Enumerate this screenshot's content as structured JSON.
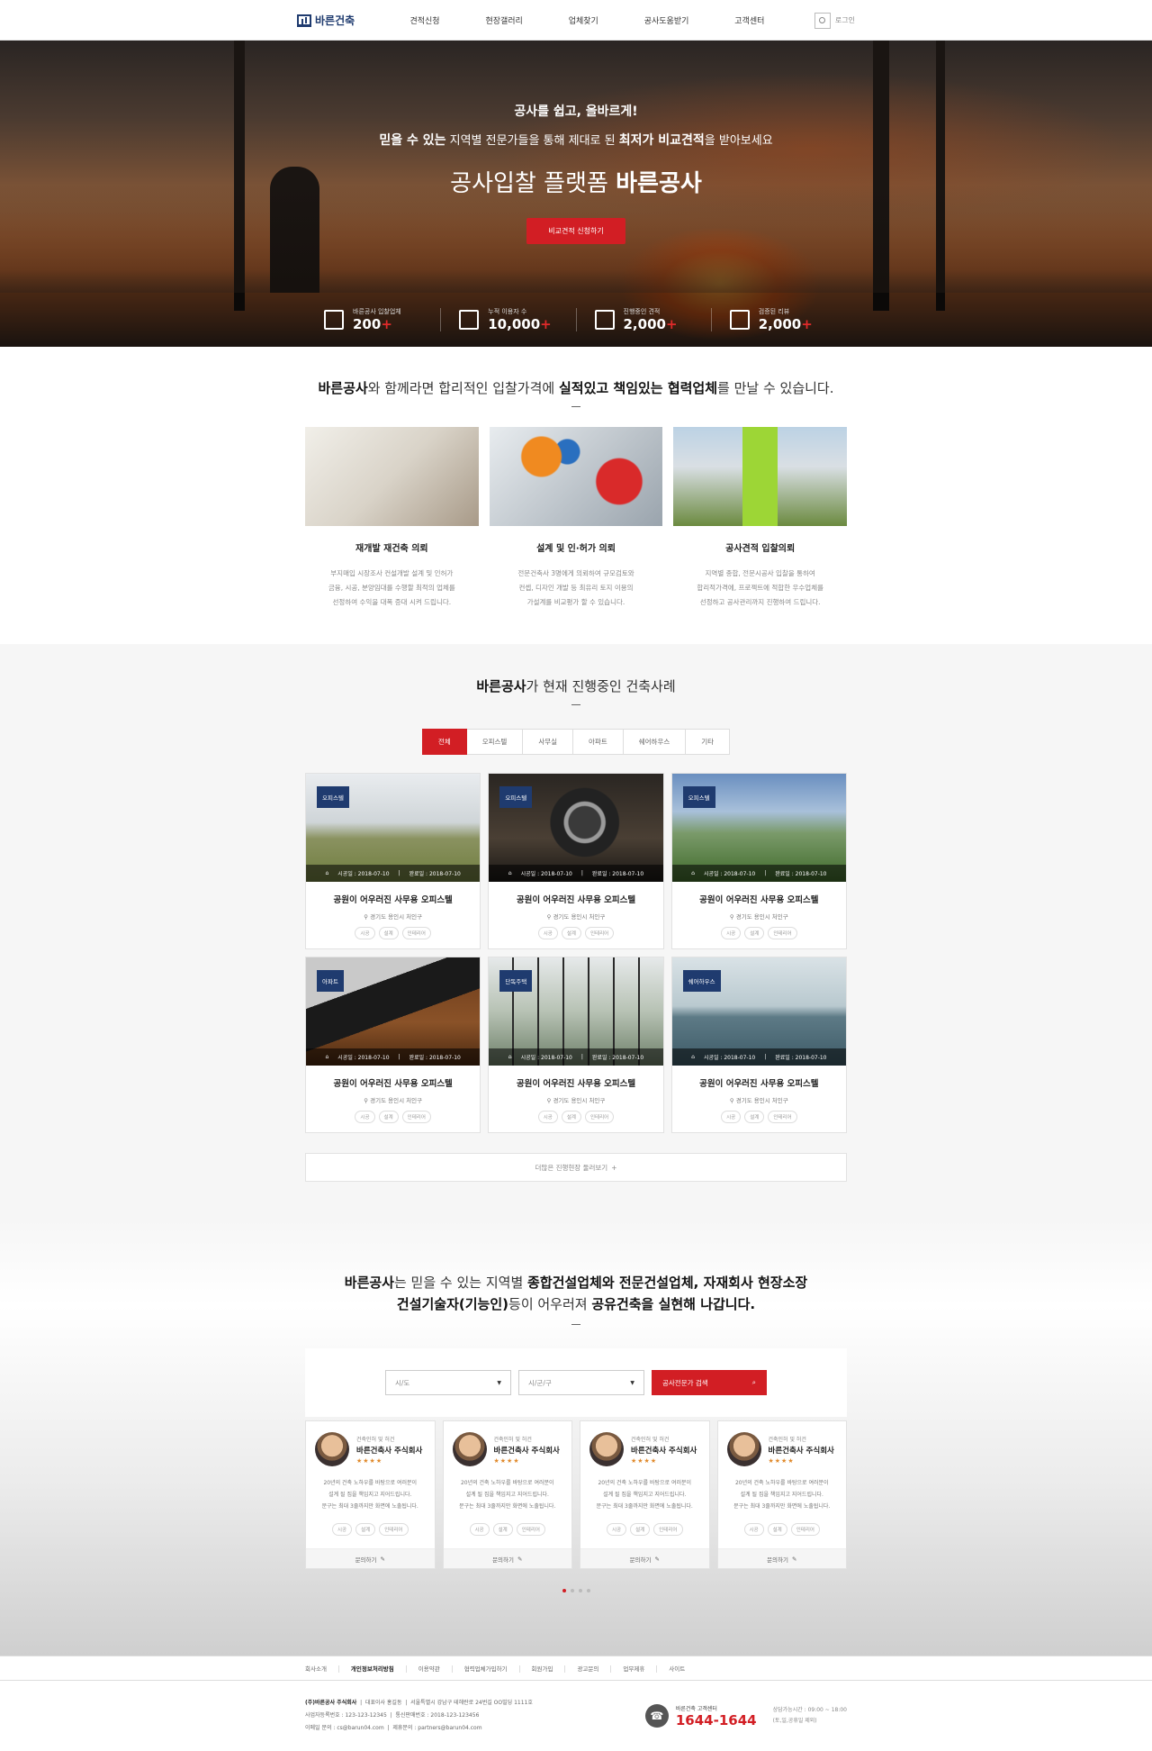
{
  "header": {
    "logo": "바른건축",
    "nav": [
      "견적신청",
      "현장갤러리",
      "업체찾기",
      "공사도움받기",
      "고객센터"
    ],
    "login": "로그인"
  },
  "hero": {
    "line1": "공사를 쉽고, 올바르게!",
    "line2_a": "믿을 수 있는",
    "line2_b": " 지역별 전문가들을 통해 제대로 된 ",
    "line2_c": "최저가 비교견적",
    "line2_d": "을 받아보세요",
    "line3_a": "공사입찰 플랫폼 ",
    "line3_b": "바른공사",
    "button": "비교견적 신청하기",
    "stats": [
      {
        "label": "바른공사 입찰업체",
        "value": "200",
        "icon": "building-icon"
      },
      {
        "label": "누적 이용자 수",
        "value": "10,000",
        "icon": "users-icon"
      },
      {
        "label": "진행중인 견적",
        "value": "2,000",
        "icon": "calculator-icon"
      },
      {
        "label": "검증된 리뷰",
        "value": "2,000",
        "icon": "review-icon"
      }
    ],
    "plus": "+"
  },
  "intro": {
    "title_a": "바른공사",
    "title_b": "와 함께라면 합리적인 입찰가격에 ",
    "title_c": "실적있고 책임있는 협력업체",
    "title_d": "를 만날 수 있습니다.",
    "cards": [
      {
        "name": "재개발 재건축 의뢰",
        "desc": [
          "부지매입 시장조사 컨설개발 설계 및 인허가",
          "금융, 시공, 분양임대를 수행할 최적의 업체를",
          "선정하여 수익을 대폭 증대 시켜 드립니다."
        ]
      },
      {
        "name": "설계 및 인·허가 의뢰",
        "desc": [
          "전문건축사 3명에게 의뢰하여 규모검토와",
          "컨셉, 디자인 개발 등 최유리 토지 이용의",
          "가설계를 비교평가 할 수 있습니다."
        ]
      },
      {
        "name": "공사견적 입찰의뢰",
        "desc": [
          "지역별 종합, 전문시공사 입찰을 통하여",
          "합리적가격에, 프로젝트에 적합한 우수업체를",
          "선정하고 공사관리까지 진행하여 드립니다."
        ]
      }
    ]
  },
  "cases": {
    "title_a": "바른공사",
    "title_b": "가 현재 진행중인 건축사례",
    "tabs": [
      "전체",
      "오피스텔",
      "사무실",
      "아파트",
      "쉐어하우스",
      "기타"
    ],
    "items": [
      {
        "badge": "오피스텔",
        "start": "시공일 : 2018-07-10",
        "end": "완료일 : 2018-07-10",
        "title": "공원이 어우러진 사무용 오피스텔",
        "loc": "경기도 용인시 처인구"
      },
      {
        "badge": "오피스텔",
        "start": "시공일 : 2018-07-10",
        "end": "완료일 : 2018-07-10",
        "title": "공원이 어우러진 사무용 오피스텔",
        "loc": "경기도 용인시 처인구"
      },
      {
        "badge": "오피스텔",
        "start": "시공일 : 2018-07-10",
        "end": "완료일 : 2018-07-10",
        "title": "공원이 어우러진 사무용 오피스텔",
        "loc": "경기도 용인시 처인구"
      },
      {
        "badge": "아파트",
        "start": "시공일 : 2018-07-10",
        "end": "완료일 : 2018-07-10",
        "title": "공원이 어우러진 사무용 오피스텔",
        "loc": "경기도 용인시 처인구"
      },
      {
        "badge": "단독주택",
        "start": "시공일 : 2018-07-10",
        "end": "완료일 : 2018-07-10",
        "title": "공원이 어우러진 사무용 오피스텔",
        "loc": "경기도 용인시 처인구"
      },
      {
        "badge": "쉐어하우스",
        "start": "시공일 : 2018-07-10",
        "end": "완료일 : 2018-07-10",
        "title": "공원이 어우러진 사무용 오피스텔",
        "loc": "경기도 용인시 처인구"
      }
    ],
    "tags": [
      "시공",
      "설계",
      "인테리어"
    ],
    "more": "더많은 진행현장 둘러보기"
  },
  "experts": {
    "l1_a": "바른공사",
    "l1_b": "는 믿을 수 있는 지역별 ",
    "l1_c": "종합건설업체와 전문건설업체, 자재회사 현장소장",
    "l2_a": "건설기술자(기능인)",
    "l2_b": "등이 어우러져 ",
    "l2_c": "공유건축을 실현해 나갑니다.",
    "sel1": "시/도",
    "sel2": "시/군/구",
    "search": "공사전문가 검색",
    "card": {
      "sub": "건축인허 및 허건",
      "name": "바른건축사 주식회사",
      "stars": "★★★★",
      "desc": [
        "20년의 건축 노하우를 바탕으로 여러분이",
        "설계 될 집을 책임지고 지어드립니다.",
        "문구는 최대 3줄까지만 화면에 노출됩니다."
      ],
      "ask": "문의하기"
    }
  },
  "footer": {
    "links": [
      "회사소개",
      "개인정보처리방침",
      "이용약관",
      "협력업체가입하기",
      "회원가입",
      "광고문의",
      "업무제휴",
      "사이트"
    ],
    "company": "(주)바른공사 주식회사",
    "ceo": "대표이사 홍길동",
    "address": "서울특별시 강남구 테헤란로 24번길 OO빌딩 1111호",
    "biz": "사업자등록번호 : 123-123-12345",
    "mail": "통신판매번호 : 2018-123-123456",
    "email1": "이메일 문의 : cs@barun04.com",
    "email2": "제휴문의 : partners@barun04.com",
    "cs_label": "바른건축 고객센터",
    "cs_num": "1644-1644",
    "hours1": "상담가능시간 : 09:00 ~ 18:00",
    "hours2": "(토,일,공휴일 제외)"
  }
}
